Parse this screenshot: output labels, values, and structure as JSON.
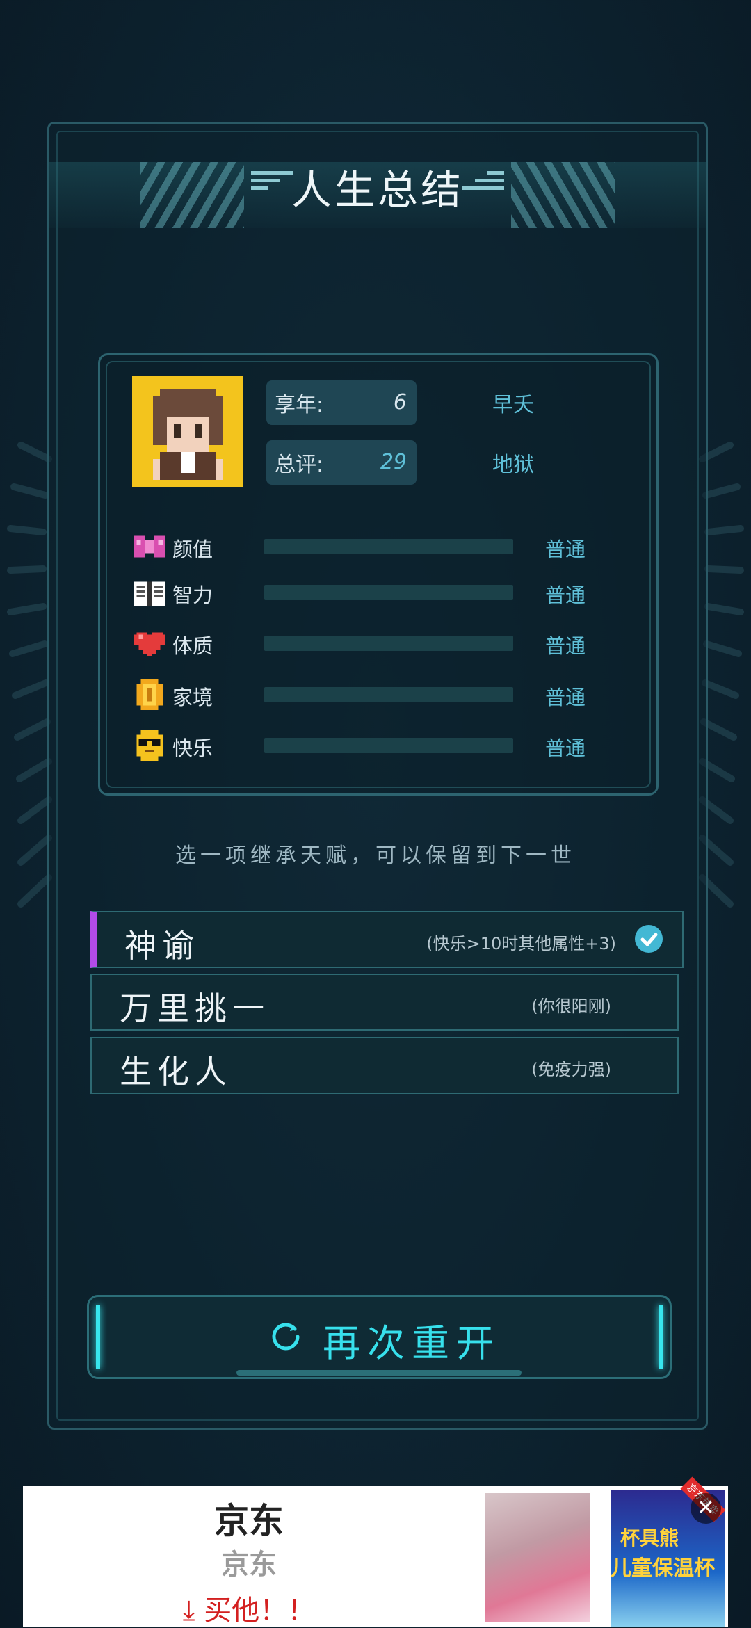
{
  "title": "人生总结",
  "summary": {
    "age_label": "享年:",
    "age_value": "6",
    "age_note": "早夭",
    "score_label": "总评:",
    "score_value": "29",
    "score_note": "地狱"
  },
  "attributes": [
    {
      "icon": "bow-icon",
      "label": "颜值",
      "grade": "普通"
    },
    {
      "icon": "book-icon",
      "label": "智力",
      "grade": "普通"
    },
    {
      "icon": "heart-icon",
      "label": "体质",
      "grade": "普通"
    },
    {
      "icon": "coin-icon",
      "label": "家境",
      "grade": "普通"
    },
    {
      "icon": "sunglasses-face-icon",
      "label": "快乐",
      "grade": "普通"
    }
  ],
  "hint": "选一项继承天赋，可以保留到下一世",
  "talents": [
    {
      "name": "神谕",
      "desc": "(快乐>10时其他属性+3)",
      "selected": true
    },
    {
      "name": "万里挑一",
      "desc": "(你很阳刚)",
      "selected": false
    },
    {
      "name": "生化人",
      "desc": "(免疫力强)",
      "selected": false
    }
  ],
  "restart_label": "再次重开",
  "ad": {
    "title": "京东",
    "subtitle": "京东",
    "cta": "买他！！",
    "image_text_1": "杯具熊",
    "image_text_2": "儿童保温杯",
    "badge": "京东热卖"
  },
  "colors": {
    "accent_cyan": "#37e0ec",
    "grade_blue": "#5fc0d8",
    "selected_bar": "#b34be8",
    "background": "#0d2330"
  }
}
